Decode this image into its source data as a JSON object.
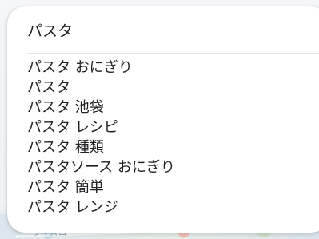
{
  "search": {
    "query": "パスタ"
  },
  "suggestions": [
    "パスタ おにぎり",
    "パスタ",
    "パスタ 池袋",
    "パスタ レシピ",
    "パスタ 種類",
    "パスタソース おにぎり",
    "パスタ 簡単",
    "パスタ レンジ"
  ],
  "background": {
    "map_label": "ワイズロ"
  }
}
